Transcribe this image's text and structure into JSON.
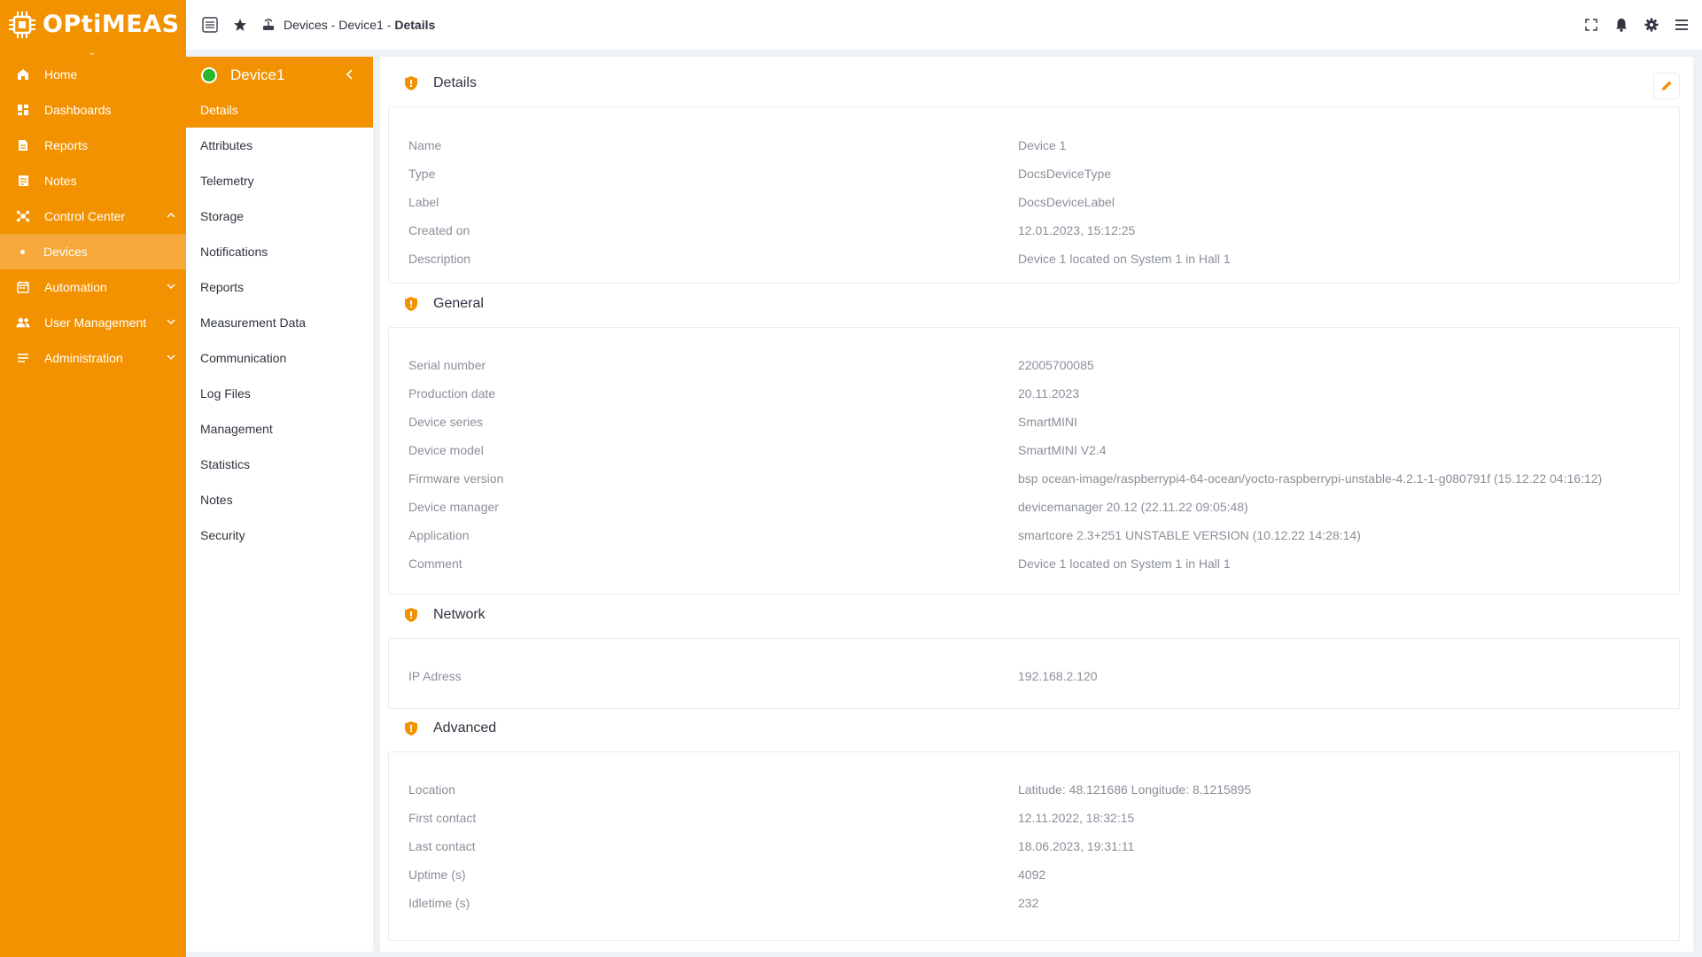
{
  "brand": {
    "name": "OPtiMEAS"
  },
  "sidebar": {
    "items": [
      {
        "label": "Home",
        "icon": "home-icon"
      },
      {
        "label": "Dashboards",
        "icon": "dashboard-icon"
      },
      {
        "label": "Reports",
        "icon": "report-icon"
      },
      {
        "label": "Notes",
        "icon": "notes-icon"
      },
      {
        "label": "Control Center",
        "icon": "control-center-icon",
        "expanded": true
      },
      {
        "label": "Devices",
        "active": true
      },
      {
        "label": "Automation",
        "icon": "calendar-icon"
      },
      {
        "label": "User Management",
        "icon": "users-icon"
      },
      {
        "label": "Administration",
        "icon": "admin-list-icon"
      }
    ]
  },
  "topbar": {
    "breadcrumb": {
      "path": "Devices - Device1 -",
      "current": "Details"
    }
  },
  "device": {
    "name": "Device1",
    "status_color": "#2bb52b",
    "menu": [
      "Details",
      "Attributes",
      "Telemetry",
      "Storage",
      "Notifications",
      "Reports",
      "Measurement Data",
      "Communication",
      "Log Files",
      "Management",
      "Statistics",
      "Notes",
      "Security"
    ]
  },
  "sections": {
    "details": {
      "title": "Details",
      "rows": [
        {
          "label": "Name",
          "value": "Device 1"
        },
        {
          "label": "Type",
          "value": "DocsDeviceType"
        },
        {
          "label": "Label",
          "value": "DocsDeviceLabel"
        },
        {
          "label": "Created on",
          "value": "12.01.2023, 15:12:25"
        },
        {
          "label": "Description",
          "value": "Device 1 located on System 1 in Hall 1"
        }
      ]
    },
    "general": {
      "title": "General",
      "rows": [
        {
          "label": "Serial number",
          "value": "22005700085"
        },
        {
          "label": "Production date",
          "value": "20.11.2023"
        },
        {
          "label": "Device series",
          "value": "SmartMINI"
        },
        {
          "label": "Device model",
          "value": "SmartMINI V2.4"
        },
        {
          "label": "Firmware version",
          "value": "bsp ocean-image/raspberrypi4-64-ocean/yocto-raspberrypi-unstable-4.2.1-1-g080791f (15.12.22 04:16:12)"
        },
        {
          "label": "Device manager",
          "value": "devicemanager 20.12 (22.11.22 09:05:48)"
        },
        {
          "label": "Application",
          "value": "smartcore 2.3+251 UNSTABLE VERSION (10.12.22 14:28:14)"
        },
        {
          "label": "Comment",
          "value": "Device 1 located on System 1 in Hall 1"
        }
      ]
    },
    "network": {
      "title": "Network",
      "rows": [
        {
          "label": "IP Adress",
          "value": "192.168.2.120"
        }
      ]
    },
    "advanced": {
      "title": "Advanced",
      "rows": [
        {
          "label": "Location",
          "value": "Latitude: 48.121686 Longitude: 8.1215895"
        },
        {
          "label": "First contact",
          "value": "12.11.2022, 18:32:15"
        },
        {
          "label": "Last contact",
          "value": "18.06.2023, 19:31:11"
        },
        {
          "label": "Uptime (s)",
          "value": "4092"
        },
        {
          "label": "Idletime (s)",
          "value": "232"
        }
      ]
    }
  },
  "colors": {
    "accent": "#f39200",
    "accent_light": "#f6a83a",
    "status_online": "#2bb52b"
  }
}
